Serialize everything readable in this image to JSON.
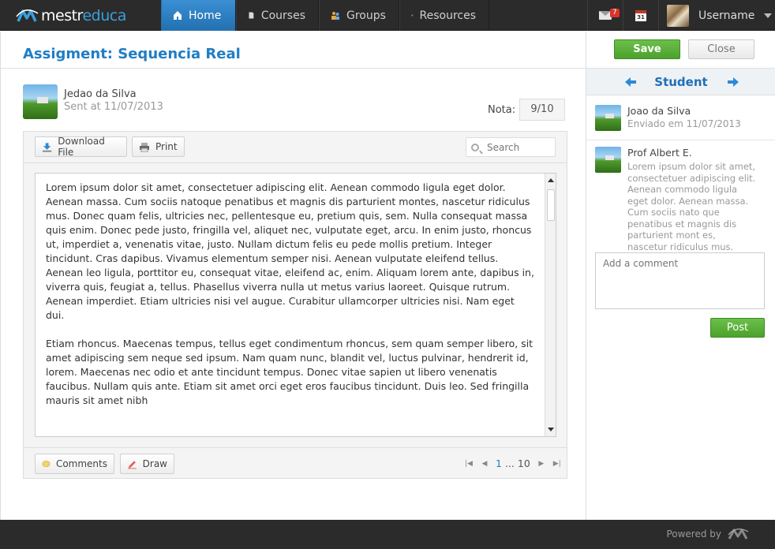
{
  "brand": {
    "part1": "mestr",
    "part2": "educa"
  },
  "nav": {
    "home": "Home",
    "courses": "Courses",
    "groups": "Groups",
    "resources": "Resources"
  },
  "header": {
    "mail_count": "7",
    "calendar_day": "31",
    "username": "Username"
  },
  "assignment": {
    "title": "Assigment: Sequencia Real",
    "author": "Jedao da Silva",
    "sent": "Sent at 11/07/2013",
    "nota_label": "Nota:",
    "nota_value": "9/10"
  },
  "toolbar": {
    "download": "Download File",
    "print": "Print",
    "search_placeholder": "Search"
  },
  "document": {
    "paragraphs": [
      "Lorem ipsum dolor sit amet, consectetuer adipiscing elit. Aenean commodo ligula eget dolor. Aenean massa. Cum sociis natoque penatibus et magnis dis parturient montes, nascetur ridiculus mus. Donec quam felis, ultricies nec, pellentesque eu, pretium quis, sem. Nulla consequat massa quis enim. Donec pede justo, fringilla vel, aliquet nec, vulputate eget, arcu. In enim justo, rhoncus ut, imperdiet a, venenatis vitae, justo. Nullam dictum felis eu pede mollis pretium. Integer tincidunt. Cras dapibus. Vivamus elementum semper nisi. Aenean vulputate eleifend tellus. Aenean leo ligula, porttitor eu, consequat vitae, eleifend ac, enim. Aliquam lorem ante, dapibus in, viverra quis, feugiat a, tellus. Phasellus viverra nulla ut metus varius laoreet. Quisque rutrum. Aenean imperdiet. Etiam ultricies nisi vel augue. Curabitur ullamcorper ultricies nisi. Nam eget dui.",
      "Etiam rhoncus. Maecenas tempus, tellus eget condimentum rhoncus, sem quam semper libero, sit amet adipiscing sem neque sed ipsum. Nam quam nunc, blandit vel, luctus pulvinar, hendrerit id, lorem. Maecenas nec odio et ante tincidunt tempus. Donec vitae sapien ut libero venenatis faucibus. Nullam quis ante. Etiam sit amet orci eget eros faucibus tincidunt. Duis leo. Sed fringilla mauris sit amet nibh"
    ]
  },
  "bottombar": {
    "comments": "Comments",
    "draw": "Draw",
    "page_current": "1",
    "page_dots": "...",
    "page_last": "10"
  },
  "sidebar": {
    "save": "Save",
    "close": "Close",
    "student_label": "Student",
    "entries": [
      {
        "name": "Joao da Silva",
        "sub": "Enviado em 11/07/2013"
      },
      {
        "name": "Prof Albert E.",
        "body": "Lorem ipsum dolor sit amet, consectetuer adipiscing elit. Aenean commodo ligula eget dolor. Aenean massa. Cum sociis nato que penatibus et magnis dis parturient mont es, nascetur ridiculus mus."
      }
    ],
    "comment_placeholder": "Add a comment",
    "post": "Post"
  },
  "footer": {
    "powered": "Powered by"
  },
  "colors": {
    "accent": "#1f7ec4",
    "nav_active": "#2f7fbf",
    "green": "#4ba12c",
    "dark": "#2b2b2b"
  }
}
